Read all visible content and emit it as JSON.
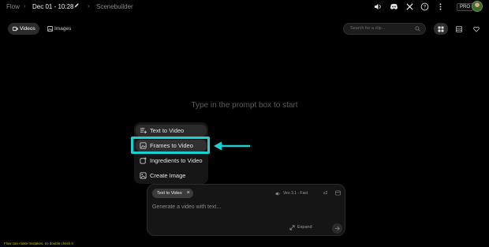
{
  "breadcrumb": {
    "root": "Flow",
    "project": "Dec 01 - 10:28",
    "section": "Scenebuilder"
  },
  "header": {
    "plan_badge": "PRO",
    "icons": [
      "volume-icon",
      "discord-icon",
      "x-icon",
      "help-icon",
      "more-vertical-icon"
    ]
  },
  "tabs": [
    {
      "label": "Videos",
      "selected": true
    },
    {
      "label": "Images",
      "selected": false
    }
  ],
  "search": {
    "placeholder": "Search for a clip..."
  },
  "empty_state": {
    "hint": "Type in the prompt box to start"
  },
  "mode_menu": {
    "items": [
      {
        "label": "Text to Video",
        "icon": "text-lines-icon"
      },
      {
        "label": "Frames to Video",
        "icon": "frames-icon"
      },
      {
        "label": "Ingredients to Video",
        "icon": "ingredients-icon"
      },
      {
        "label": "Create Image",
        "icon": "image-icon"
      }
    ]
  },
  "composer": {
    "mode_chip": "Text to Video",
    "chip_close": "×",
    "model": "Veo 3.1 - Fast",
    "output_count": "x2",
    "placeholder": "Generate a video with text...",
    "expand_label": "Expand"
  },
  "footer": {
    "notice": "Flow can make mistakes, so double check it"
  },
  "colors": {
    "highlight": "#1ad0d0",
    "notice": "#d6c400"
  }
}
